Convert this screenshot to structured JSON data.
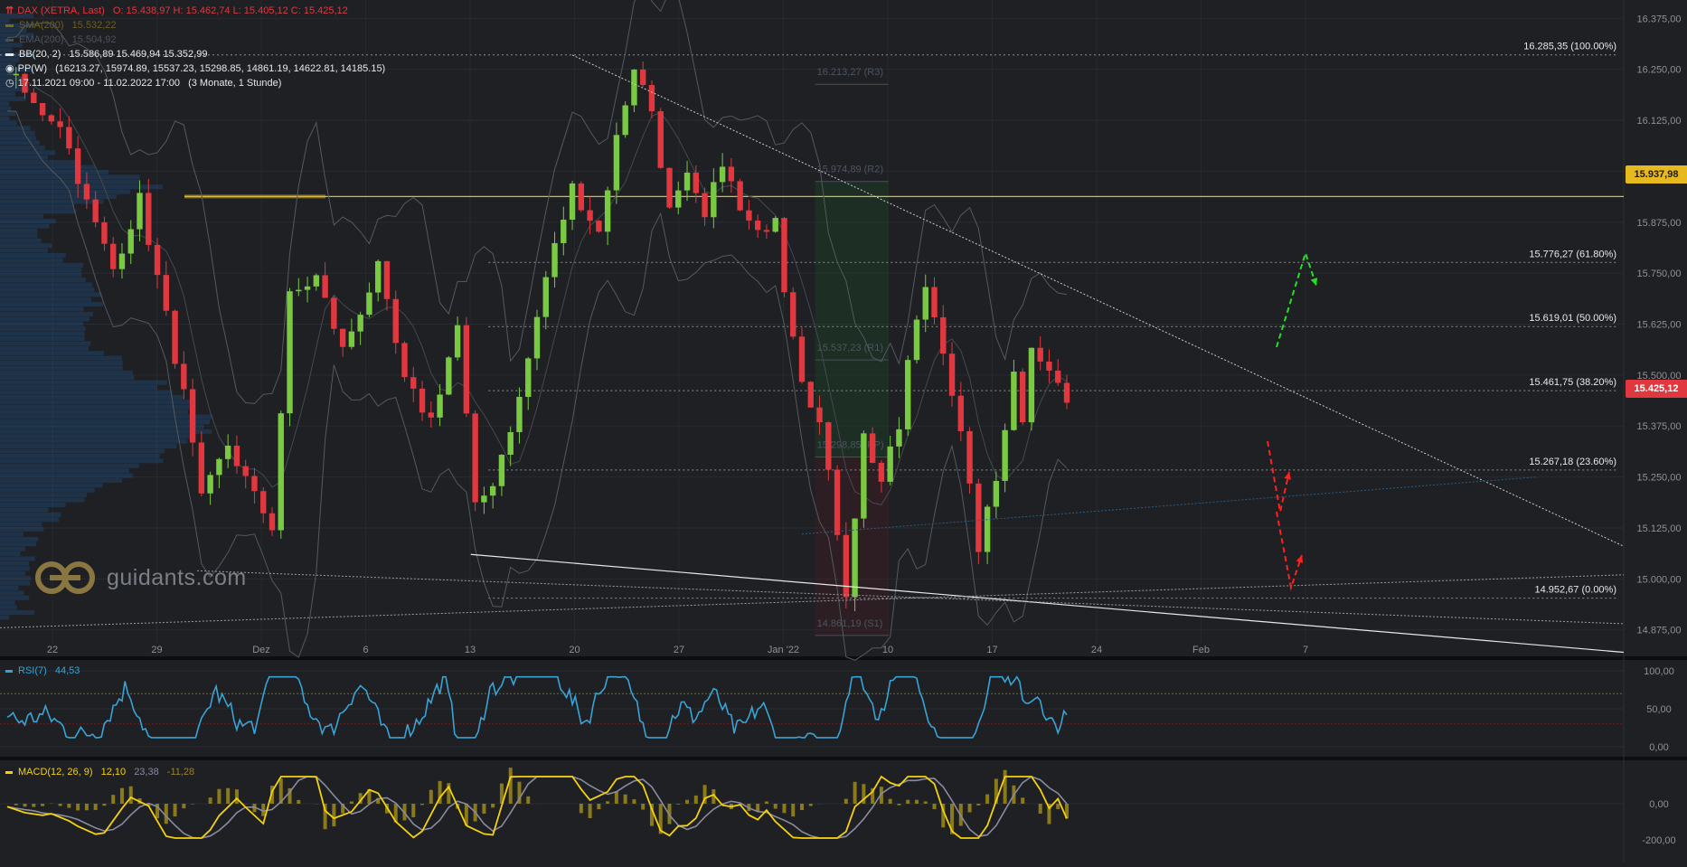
{
  "header": {
    "instrument": "DAX (XETRA, Last)",
    "ohlc": "O: 15.438,97  H: 15.462,74  L: 15.405,12  C: 15.425,12",
    "sma200_label": "SMA(200)",
    "sma200_value": "15.532,22",
    "ema200_label": "EMA(200)",
    "ema200_value": "15.504,92",
    "bb_label": "BB(20, 2)",
    "bb_values": "15.586,89  15.469,94  15.352,99",
    "pp_label": "PP(W)",
    "pp_values": "(16213.27, 15974.89, 15537.23, 15298.85, 14861.19, 14622.81, 14185.15)",
    "range_label": "17.11.2021 09:00 - 11.02.2022 17:00",
    "range_duration": "(3 Monate, 1 Stunde)"
  },
  "logo": {
    "text": "guidants.com"
  },
  "colors": {
    "background": "#1e2024",
    "up": "#7ac943",
    "down": "#e0383e",
    "gold": "#e6b91e",
    "rsi": "#3aa3d6",
    "macd": "#f4d10f",
    "signal": "#8a8aa0",
    "green_arrow": "#22e022",
    "red_arrow": "#ff2020"
  },
  "price_axis": {
    "ticks": [
      "16.375,00",
      "16.250,00",
      "16.125,00",
      "16.000,00",
      "15.875,00",
      "15.750,00",
      "15.625,00",
      "15.500,00",
      "15.375,00",
      "15.250,00",
      "15.125,00",
      "15.000,00",
      "14.875,00"
    ],
    "tag_level": "15.937,98",
    "tag_current": "15.425,12"
  },
  "fibonacci": [
    {
      "label": "16.285,35 (100.00%)",
      "price": 16285.35
    },
    {
      "label": "15.776,27 (61.80%)",
      "price": 15776.27
    },
    {
      "label": "15.619,01 (50.00%)",
      "price": 15619.01
    },
    {
      "label": "15.461,75 (38.20%)",
      "price": 15461.75
    },
    {
      "label": "15.267,18 (23.60%)",
      "price": 15267.18
    },
    {
      "label": "14.952,67 (0.00%)",
      "price": 14952.67
    }
  ],
  "pivots": [
    {
      "label": "16.213,27 (R3)",
      "price": 16213.27
    },
    {
      "label": "15.974,89 (R2)",
      "price": 15974.89
    },
    {
      "label": "15.537,23 (R1)",
      "price": 15537.23
    },
    {
      "label": "15.298,85 (PP)",
      "price": 15298.85
    },
    {
      "label": "14.861,19 (S1)",
      "price": 14861.19
    }
  ],
  "time_axis": [
    {
      "label": "22"
    },
    {
      "label": "29"
    },
    {
      "label": "Dez"
    },
    {
      "label": "6"
    },
    {
      "label": "13"
    },
    {
      "label": "20"
    },
    {
      "label": "27"
    },
    {
      "label": "Jan '22"
    },
    {
      "label": "10"
    },
    {
      "label": "17"
    },
    {
      "label": "24"
    },
    {
      "label": "Feb"
    },
    {
      "label": "7"
    }
  ],
  "rsi": {
    "label": "RSI(7)",
    "value": "44,53",
    "ticks": [
      "100,00",
      "50,00",
      "0,00"
    ],
    "upper": 70,
    "lower": 30
  },
  "macd": {
    "label": "MACD(12, 26, 9)",
    "value": "12,10",
    "signal": "23,38",
    "hist": "-11,28",
    "ticks": [
      "0,00",
      "-200,00"
    ]
  },
  "chart_data": {
    "type": "candlestick",
    "instrument": "DAX (XETRA, Last)",
    "interval": "1 Stunde",
    "ylim": [
      14810,
      16420
    ],
    "x": [
      "22",
      "29",
      "Dez",
      "6",
      "13",
      "20",
      "27",
      "Jan '22",
      "10",
      "17",
      "24",
      "Feb",
      "7"
    ],
    "path_close": [
      [
        0,
        16250
      ],
      [
        3,
        16160
      ],
      [
        6,
        16120
      ],
      [
        9,
        15920
      ],
      [
        12,
        15760
      ],
      [
        15,
        15930
      ],
      [
        20,
        15450
      ],
      [
        22,
        15190
      ],
      [
        25,
        15330
      ],
      [
        28,
        15200
      ],
      [
        30,
        15130
      ],
      [
        32,
        15690
      ],
      [
        35,
        15740
      ],
      [
        38,
        15560
      ],
      [
        42,
        15760
      ],
      [
        45,
        15480
      ],
      [
        48,
        15390
      ],
      [
        51,
        15620
      ],
      [
        53,
        15170
      ],
      [
        55,
        15240
      ],
      [
        58,
        15440
      ],
      [
        61,
        15740
      ],
      [
        64,
        15960
      ],
      [
        67,
        15850
      ],
      [
        69,
        16080
      ],
      [
        71,
        16260
      ],
      [
        73,
        16150
      ],
      [
        75,
        15900
      ],
      [
        77,
        15980
      ],
      [
        79,
        15880
      ],
      [
        81,
        16030
      ],
      [
        83,
        15900
      ],
      [
        85,
        15840
      ],
      [
        87,
        15900
      ],
      [
        88,
        15720
      ],
      [
        90,
        15500
      ],
      [
        92,
        15380
      ],
      [
        94,
        15120
      ],
      [
        95,
        14970
      ],
      [
        97,
        15350
      ],
      [
        99,
        15240
      ],
      [
        101,
        15370
      ],
      [
        102,
        15530
      ],
      [
        104,
        15720
      ],
      [
        106,
        15570
      ],
      [
        108,
        15350
      ],
      [
        110,
        15080
      ],
      [
        112,
        15240
      ],
      [
        114,
        15520
      ],
      [
        115,
        15380
      ],
      [
        116,
        15580
      ],
      [
        118,
        15520
      ],
      [
        120,
        15430
      ]
    ]
  }
}
